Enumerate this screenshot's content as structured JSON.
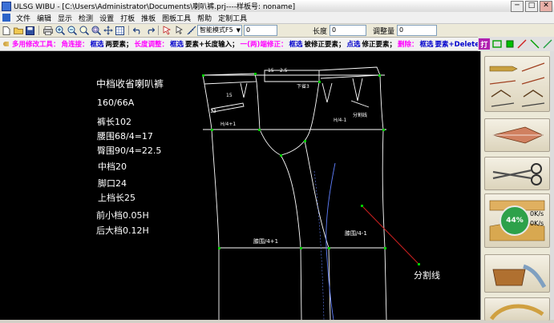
{
  "window": {
    "title": "ULSG WIBU - [C:\\Users\\Administrator\\Documents\\喇叭裤.prj----样板号: noname]",
    "min_label": "─",
    "max_label": "□",
    "close_label": "✕"
  },
  "menu": [
    "文件",
    "编辑",
    "显示",
    "检测",
    "设置",
    "打板",
    "推板",
    "图板工具",
    "帮助",
    "定制工具"
  ],
  "toolbar": {
    "mode_value": "智能模式F5",
    "field1_value": "0",
    "length_label": "长度",
    "length_value": "0",
    "adjust_label": "调整量",
    "adjust_value": "0"
  },
  "hintbar": {
    "segments": [
      {
        "text": "多用修改工具：",
        "color": "#ff00ff"
      },
      {
        "text": "角连接：",
        "color": "#ff00ff"
      },
      {
        "text": "框选",
        "color": "#0000cc"
      },
      {
        "text": "两要素；",
        "color": "#000000"
      },
      {
        "text": "长度调整：",
        "color": "#ff00ff"
      },
      {
        "text": "框选",
        "color": "#0000cc"
      },
      {
        "text": "要素+长度输入；",
        "color": "#000000"
      },
      {
        "text": "一(两)端修正：",
        "color": "#ff00ff"
      },
      {
        "text": "框选",
        "color": "#0000cc"
      },
      {
        "text": "被修正要素；",
        "color": "#000000"
      },
      {
        "text": "点选",
        "color": "#0000cc"
      },
      {
        "text": "修正要素；",
        "color": "#000000"
      },
      {
        "text": "删除：",
        "color": "#ff00ff"
      },
      {
        "text": "框选",
        "color": "#0000cc"
      },
      {
        "text": "要素+Delete",
        "color": "#0000cc"
      }
    ],
    "tool_label": "打"
  },
  "pattern_info": {
    "title": "中档收省喇叭裤",
    "lines": [
      "160/66A",
      "裤长102",
      "腰围68/4=17",
      "臀围90/4=22.5",
      "中档20",
      "脚口24",
      "上档长25",
      "前小档0.05H",
      "后大档0.12H"
    ]
  },
  "drawing_labels": {
    "dim_15": "15",
    "dim_2_5": "2.5",
    "dart_text": "下省3",
    "h4_left": "H/4+1",
    "h4_right": "H/4-1",
    "split_small": "分割线",
    "hip_front": "膝围/4+1",
    "hip_back": "膝围/4-1",
    "split_line": "分割线",
    "n13": "13",
    "n15b": "15"
  },
  "right_panel": {
    "percent": "44%",
    "speed_up": "0K/s",
    "speed_down": "0K/s"
  },
  "colors": {
    "pattern_lines": "#ffffff",
    "point_marker": "#00cc00",
    "annotation_line": "#cc2020",
    "curve_blue": "#6080ff",
    "percent_badge": "#2da14a"
  }
}
